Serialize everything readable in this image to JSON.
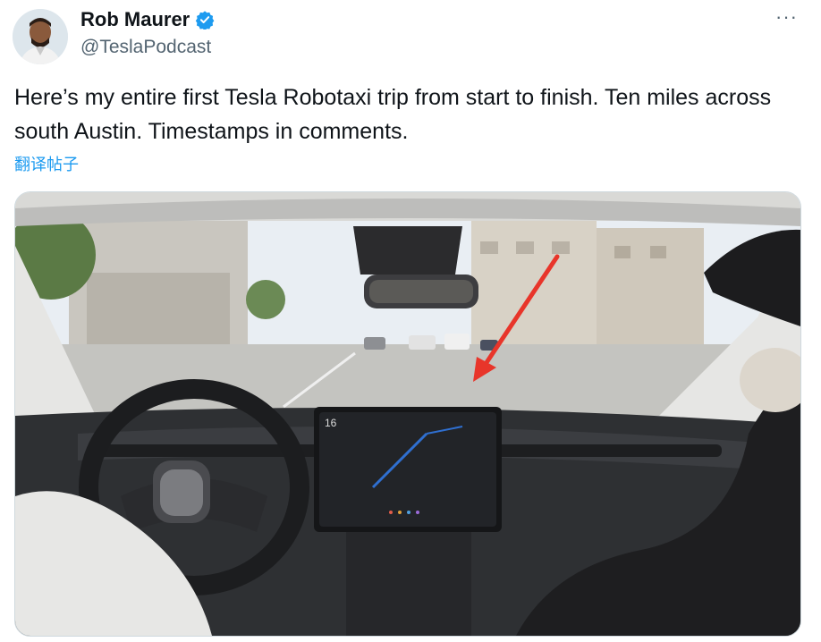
{
  "author": {
    "name": "Rob Maurer",
    "handle": "@TeslaPodcast",
    "avatar_icon": "avatar-photo-icon",
    "verified_icon": "verified-badge-icon"
  },
  "header": {
    "more_label": "···",
    "more_icon": "more-options-icon"
  },
  "tweet": {
    "text": "Here’s my entire first Tesla Robotaxi trip from start to finish. Ten miles across south Austin. Timestamps in comments.",
    "translate_label": "翻译帖子"
  },
  "media": {
    "description_icon": "car-interior-photo-icon",
    "screen_speed": "16"
  },
  "colors": {
    "accent": "#1d9bf0",
    "secondary_text": "#536471",
    "arrow": "#e8352a"
  }
}
